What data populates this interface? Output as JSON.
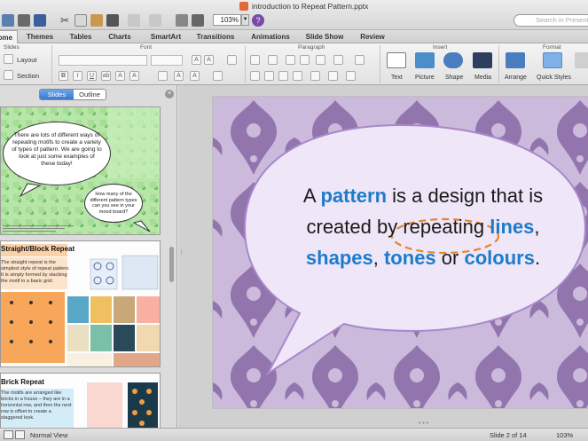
{
  "window": {
    "title": "introduction to Repeat Pattern.pptx",
    "search_placeholder": "Search in Presentation",
    "zoom": "103%"
  },
  "ribbon": {
    "tabs": [
      "Home",
      "Themes",
      "Tables",
      "Charts",
      "SmartArt",
      "Transitions",
      "Animations",
      "Slide Show",
      "Review"
    ],
    "selected_tab": "Home",
    "groups": {
      "slides": "Slides",
      "font": "Font",
      "paragraph": "Paragraph",
      "insert": "Insert",
      "format": "Format"
    },
    "buttons": {
      "layout": "Layout",
      "section": "Section",
      "text": "Text",
      "picture": "Picture",
      "shape": "Shape",
      "media": "Media",
      "arrange": "Arrange",
      "quick_styles": "Quick Styles"
    }
  },
  "left_panel": {
    "tab_slides": "Slides",
    "tab_outline": "Outline",
    "thumb1": {
      "bubble_text": "There are lots of different ways of repeating motifs to create a variety of types of pattern. We are going to look at just some examples of these today!",
      "small_bubble_text": "How many of the different pattern types can you see in your mood board?"
    },
    "thumb2": {
      "title": "Straight/Block Repeat",
      "desc": "The straight repeat is the simplest style of repeat pattern. It is simply formed by stacking the motif in a basic grid."
    },
    "thumb3": {
      "title": "Brick Repeat",
      "desc": "The motifs are arranged like bricks in a house – they are in a horizontal row, and then the next row is offset to create a staggered look."
    }
  },
  "slide": {
    "text": {
      "p1": "A ",
      "w_pattern": "pattern",
      "p2": " is a design that is",
      "p3": "created by ",
      "w_repeating": "repeating",
      "p4": " ",
      "w_lines": "lines",
      "p5": ",",
      "w_shapes": "shapes",
      "p6": ", ",
      "w_tones": "tones",
      "p7": " or ",
      "w_colours": "colours",
      "p8": "."
    },
    "colors": {
      "damask_purple": "#8a6aa8",
      "bubble_fill": "#efe6f7",
      "highlight_blue": "#1c7ccb",
      "circle_orange": "#e8842a"
    }
  },
  "status": {
    "view": "Normal View",
    "slide_count": "Slide 2 of 14",
    "zoom": "103%"
  }
}
